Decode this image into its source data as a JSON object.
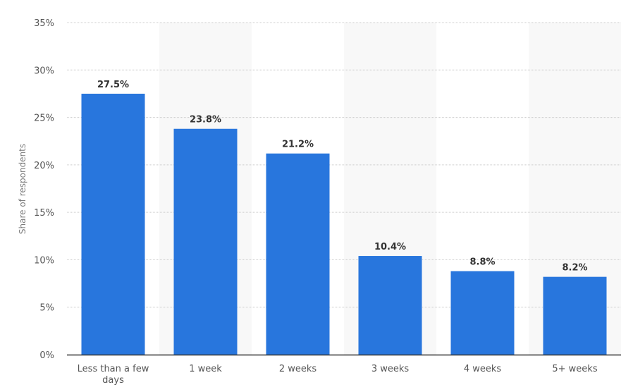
{
  "chart_data": {
    "type": "bar",
    "title": "",
    "xlabel": "",
    "ylabel": "Share of respondents",
    "ylim": [
      0,
      35
    ],
    "yticks": [
      0,
      5,
      10,
      15,
      20,
      25,
      30,
      35
    ],
    "ytick_labels": [
      "0%",
      "5%",
      "10%",
      "15%",
      "20%",
      "25%",
      "30%",
      "35%"
    ],
    "grid": true,
    "categories": [
      "Less than a few days",
      "1 week",
      "2 weeks",
      "3 weeks",
      "4 weeks",
      "5+ weeks"
    ],
    "category_lines": [
      [
        "Less than a few",
        "days"
      ],
      [
        "1 week"
      ],
      [
        "2 weeks"
      ],
      [
        "3 weeks"
      ],
      [
        "4 weeks"
      ],
      [
        "5+ weeks"
      ]
    ],
    "values": [
      27.5,
      23.8,
      21.2,
      10.4,
      8.8,
      8.2
    ],
    "data_labels": [
      "27.5%",
      "23.8%",
      "21.2%",
      "10.4%",
      "8.8%",
      "8.2%"
    ],
    "unit": "%",
    "colors": {
      "bar": "#2876dd",
      "band": "#f8f8f8",
      "grid": "#cccccc",
      "axis": "#333333"
    }
  }
}
